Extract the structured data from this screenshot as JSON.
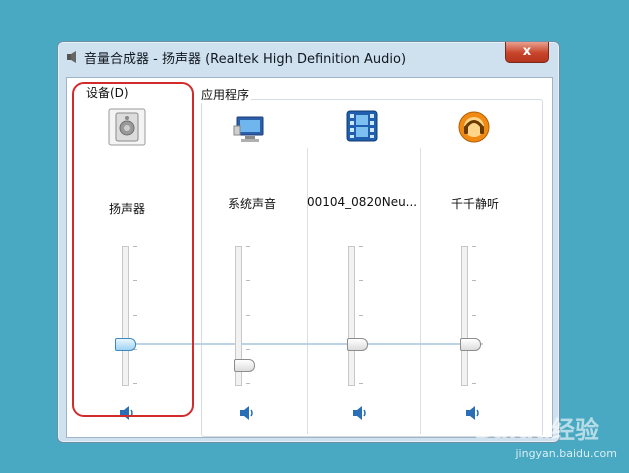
{
  "window": {
    "title": "音量合成器 - 扬声器 (Realtek High Definition Audio)",
    "close_label": "x"
  },
  "device_group": {
    "label": "设备(D)",
    "device": {
      "name": "扬声器",
      "icon": "speaker-device-icon",
      "volume": 0.6
    }
  },
  "app_group": {
    "label": "应用程序",
    "apps": [
      {
        "name": "系统声音",
        "icon": "system-sounds-icon",
        "volume": 0.45
      },
      {
        "name": "00104_0820Neu...",
        "icon": "video-player-icon",
        "volume": 0.6
      },
      {
        "name": "千千静听",
        "icon": "ttplayer-icon",
        "volume": 0.6
      }
    ]
  },
  "watermark": {
    "text": "Baidu经验",
    "url": "jingyan.baidu.com"
  },
  "colors": {
    "background": "#49a9c3",
    "highlight": "#d12b2b",
    "accent": "#3c88c0"
  }
}
